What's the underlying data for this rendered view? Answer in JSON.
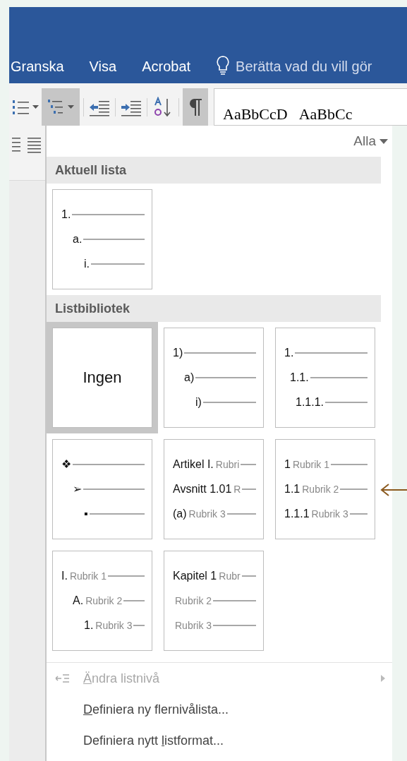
{
  "ribbon": {
    "tabs": [
      "Granska",
      "Visa",
      "Acrobat"
    ],
    "tell_me": "Berätta vad du vill gör"
  },
  "toolbar": {
    "buttons": [
      {
        "kind": "numbering",
        "selected": false
      },
      {
        "kind": "multilevel",
        "selected": true
      },
      {
        "kind": "decrease-indent",
        "selected": false
      },
      {
        "kind": "increase-indent",
        "selected": false
      },
      {
        "kind": "sort",
        "selected": false
      },
      {
        "kind": "pilcrow",
        "selected": true
      }
    ],
    "styles": [
      "AaBbCcD",
      "AaBbCc"
    ]
  },
  "panel": {
    "filter": "Alla",
    "sections": [
      {
        "title": "Aktuell lista",
        "tiles": [
          {
            "kind": "levels",
            "selected": false,
            "levels": [
              {
                "marker": "1."
              },
              {
                "marker": "a."
              },
              {
                "marker": "i."
              }
            ]
          }
        ]
      },
      {
        "title": "Listbibliotek",
        "tiles": [
          {
            "kind": "none",
            "selected": true,
            "label": "Ingen"
          },
          {
            "kind": "levels",
            "selected": false,
            "levels": [
              {
                "marker": "1)"
              },
              {
                "marker": "a)"
              },
              {
                "marker": "i)"
              }
            ]
          },
          {
            "kind": "levels",
            "selected": false,
            "levels": [
              {
                "marker": "1."
              },
              {
                "marker": "1.1."
              },
              {
                "marker": "1.1.1."
              }
            ]
          },
          {
            "kind": "levels",
            "selected": false,
            "levels": [
              {
                "marker": "❖"
              },
              {
                "marker": "➢"
              },
              {
                "marker": "▪"
              }
            ]
          },
          {
            "kind": "headings",
            "selected": false,
            "levels": [
              {
                "marker": "Artikel I.",
                "label": "Rubri"
              },
              {
                "marker": "Avsnitt 1.01",
                "label": "R"
              },
              {
                "marker": "(a)",
                "label": "Rubrik 3"
              }
            ]
          },
          {
            "kind": "headings",
            "selected": false,
            "levels": [
              {
                "marker": "1",
                "label": "Rubrik 1"
              },
              {
                "marker": "1.1",
                "label": "Rubrik 2"
              },
              {
                "marker": "1.1.1",
                "label": "Rubrik 3"
              }
            ]
          },
          {
            "kind": "levels",
            "selected": false,
            "levels": [
              {
                "marker": "I.",
                "label": "Rubrik 1"
              },
              {
                "marker": "A.",
                "label": "Rubrik 2"
              },
              {
                "marker": "1.",
                "label": "Rubrik 3"
              }
            ]
          },
          {
            "kind": "headings",
            "selected": false,
            "levels": [
              {
                "marker": "Kapitel 1",
                "label": "Rubr"
              },
              {
                "label": "Rubrik 2"
              },
              {
                "label": "Rubrik 3"
              }
            ]
          }
        ]
      }
    ],
    "menu": [
      {
        "access_key": "Ä",
        "text_after": "ndra listnivå",
        "disabled": true,
        "submenu": true,
        "kind": "level"
      },
      {
        "access_key": "D",
        "text_after": "efiniera ny flernivålista...",
        "disabled": false,
        "submenu": false,
        "kind": "command"
      },
      {
        "text_before": "Definiera nytt ",
        "access_key": "l",
        "text_after": "istformat...",
        "disabled": false,
        "submenu": false,
        "kind": "command"
      }
    ]
  }
}
